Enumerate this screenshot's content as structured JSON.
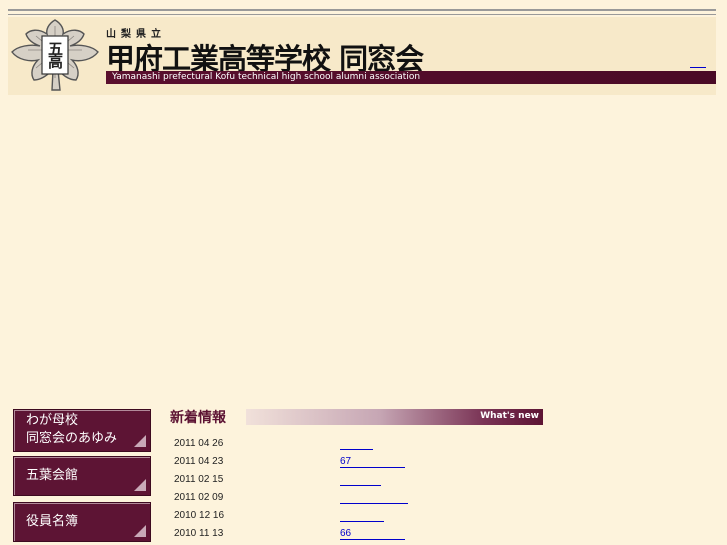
{
  "header": {
    "prefecture_label": "山梨県立",
    "school_name": "甲府工業高等学校 同窓会",
    "english_name": "Yamanashi prefectural Kofu technical high school alumni association",
    "emblem_text": "五高",
    "brand_color": "#5d1434"
  },
  "nav": {
    "items": [
      {
        "label": "わが母校\n同窓会のあゆみ"
      },
      {
        "label": "五葉会館"
      },
      {
        "label": "役員名簿"
      }
    ]
  },
  "news": {
    "title": "新着情報",
    "bar_label": "What's new",
    "items": [
      {
        "date": "2011 04 26",
        "link": ""
      },
      {
        "date": "2011 04 23",
        "link": "67"
      },
      {
        "date": "2011 02 15",
        "link": ""
      },
      {
        "date": "2011 02 09",
        "link": ""
      },
      {
        "date": "2010 12 16",
        "link": ""
      },
      {
        "date": "2010 11 13",
        "link": "66"
      }
    ]
  }
}
